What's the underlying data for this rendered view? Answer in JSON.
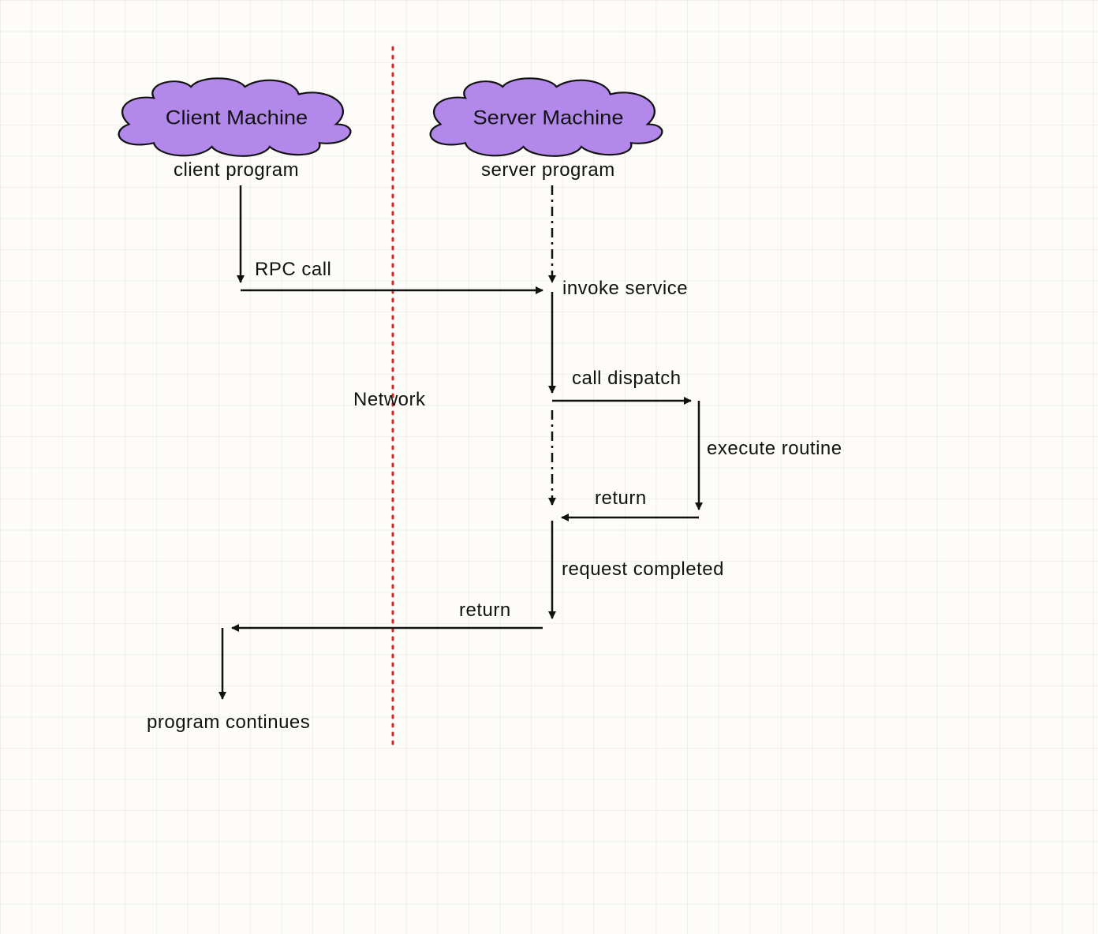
{
  "clouds": {
    "client": "Client Machine",
    "server": "Server Machine"
  },
  "labels": {
    "client_program": "client program",
    "server_program": "server program",
    "rpc_call": "RPC call",
    "invoke_service": "invoke service",
    "call_dispatch": "call dispatch",
    "execute_routine": "execute routine",
    "return_dispatch": "return",
    "request_completed": "request completed",
    "return_network": "return",
    "program_continues": "program continues",
    "network": "Network"
  }
}
